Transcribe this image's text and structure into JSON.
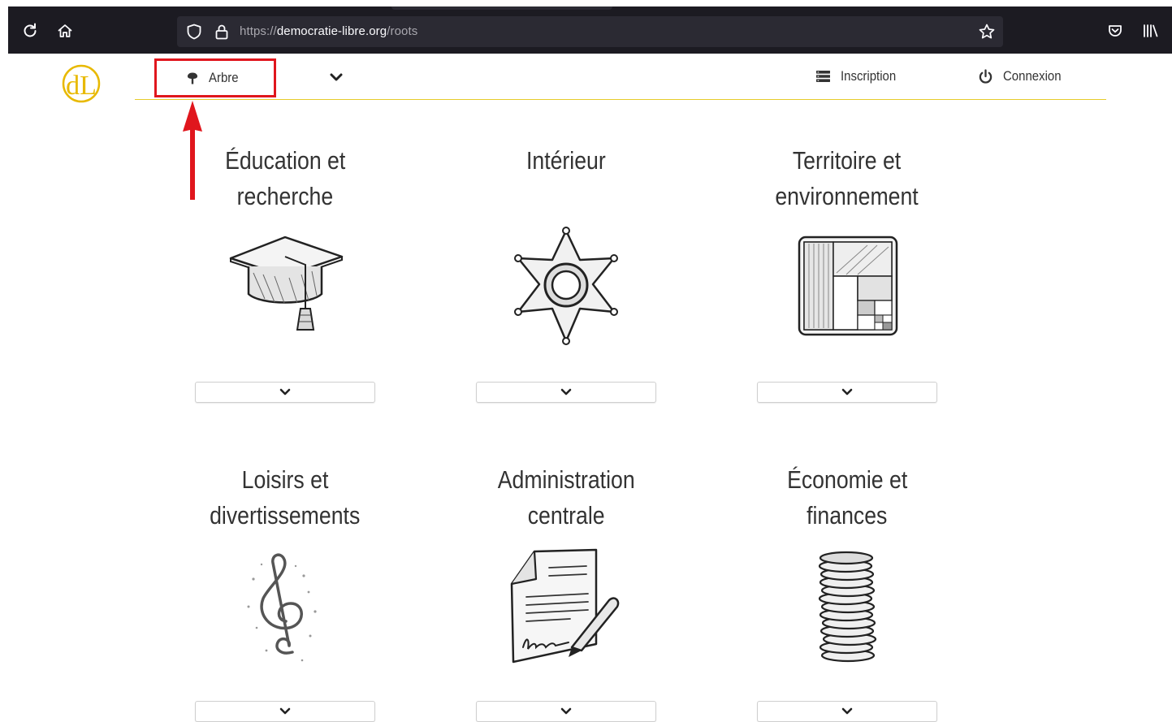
{
  "browser": {
    "url_scheme": "https://",
    "url_host": "democratie-libre.org",
    "url_path": "/roots",
    "icons": [
      "reload-icon",
      "home-icon",
      "shield-icon",
      "lock-icon",
      "bookmark-star-icon",
      "pocket-icon",
      "library-icon"
    ]
  },
  "site": {
    "logo_text": "dL",
    "nav": {
      "arbre_label": "Arbre",
      "inscription_label": "Inscription",
      "connexion_label": "Connexion"
    }
  },
  "colors": {
    "accent_yellow": "#e6cc2a",
    "logo_gold": "#e8b900",
    "highlight_red": "#e0161d",
    "text": "#333333",
    "chrome_bg": "#1c1b22",
    "urlbar_bg": "#2b2a33"
  },
  "categories": [
    {
      "line1": "Éducation et",
      "line2": "recherche",
      "icon": "graduation-cap-icon"
    },
    {
      "line1": "Intérieur",
      "line2": "",
      "icon": "sheriff-star-icon"
    },
    {
      "line1": "Territoire et",
      "line2": "environnement",
      "icon": "territory-map-icon"
    },
    {
      "line1": "Loisirs et",
      "line2": "divertissements",
      "icon": "treble-clef-icon"
    },
    {
      "line1": "Administration",
      "line2": "centrale",
      "icon": "signed-document-icon"
    },
    {
      "line1": "Économie et",
      "line2": "finances",
      "icon": "coin-stack-icon"
    }
  ]
}
